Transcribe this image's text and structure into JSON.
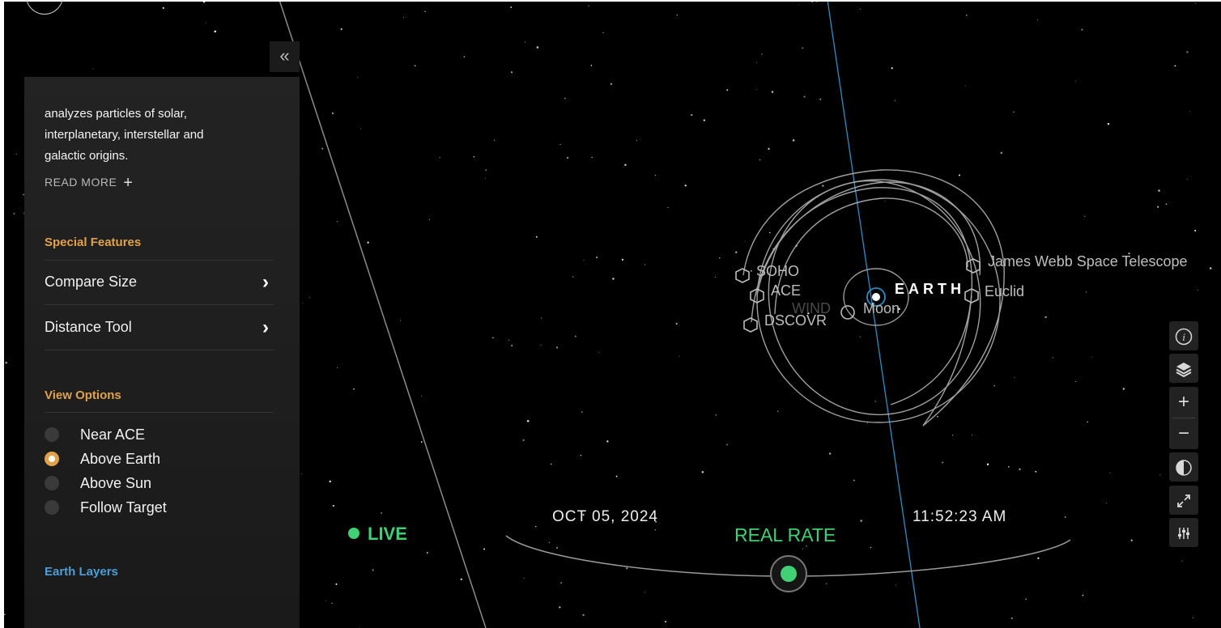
{
  "panel": {
    "collapse_icon": "double-chevron-left",
    "description": "analyzes particles of solar, interplanetary, interstellar and galactic origins.",
    "read_more": "READ MORE",
    "special_features_title": "Special Features",
    "features": [
      {
        "label": "Compare Size"
      },
      {
        "label": "Distance Tool"
      }
    ],
    "view_options_title": "View Options",
    "view_options": [
      {
        "label": "Near ACE",
        "selected": false
      },
      {
        "label": "Above Earth",
        "selected": true
      },
      {
        "label": "Above Sun",
        "selected": false
      },
      {
        "label": "Follow Target",
        "selected": false
      }
    ],
    "earth_layers_title": "Earth Layers"
  },
  "scene": {
    "earth_label": "EARTH",
    "spacecraft": {
      "soho": "SOHO",
      "ace": "ACE",
      "dscovr": "DSCOVR",
      "wind": "WIND",
      "moon": "Moon",
      "jwst": "James Webb Space Telescope",
      "euclid": "Euclid"
    }
  },
  "timeline": {
    "live_label": "LIVE",
    "date": "OCT 05, 2024",
    "time": "11:52:23 AM",
    "rate_label": "REAL RATE"
  },
  "colors": {
    "accent_orange": "#e1a24a",
    "live_green": "#3fd174",
    "layer_blue": "#4a9fd8",
    "panel_bg": "#1f1f1f"
  },
  "controls": [
    "info-icon",
    "layers-icon",
    "zoom-in-icon",
    "zoom-out-icon",
    "lighting-icon",
    "fullscreen-icon",
    "settings-sliders-icon"
  ]
}
